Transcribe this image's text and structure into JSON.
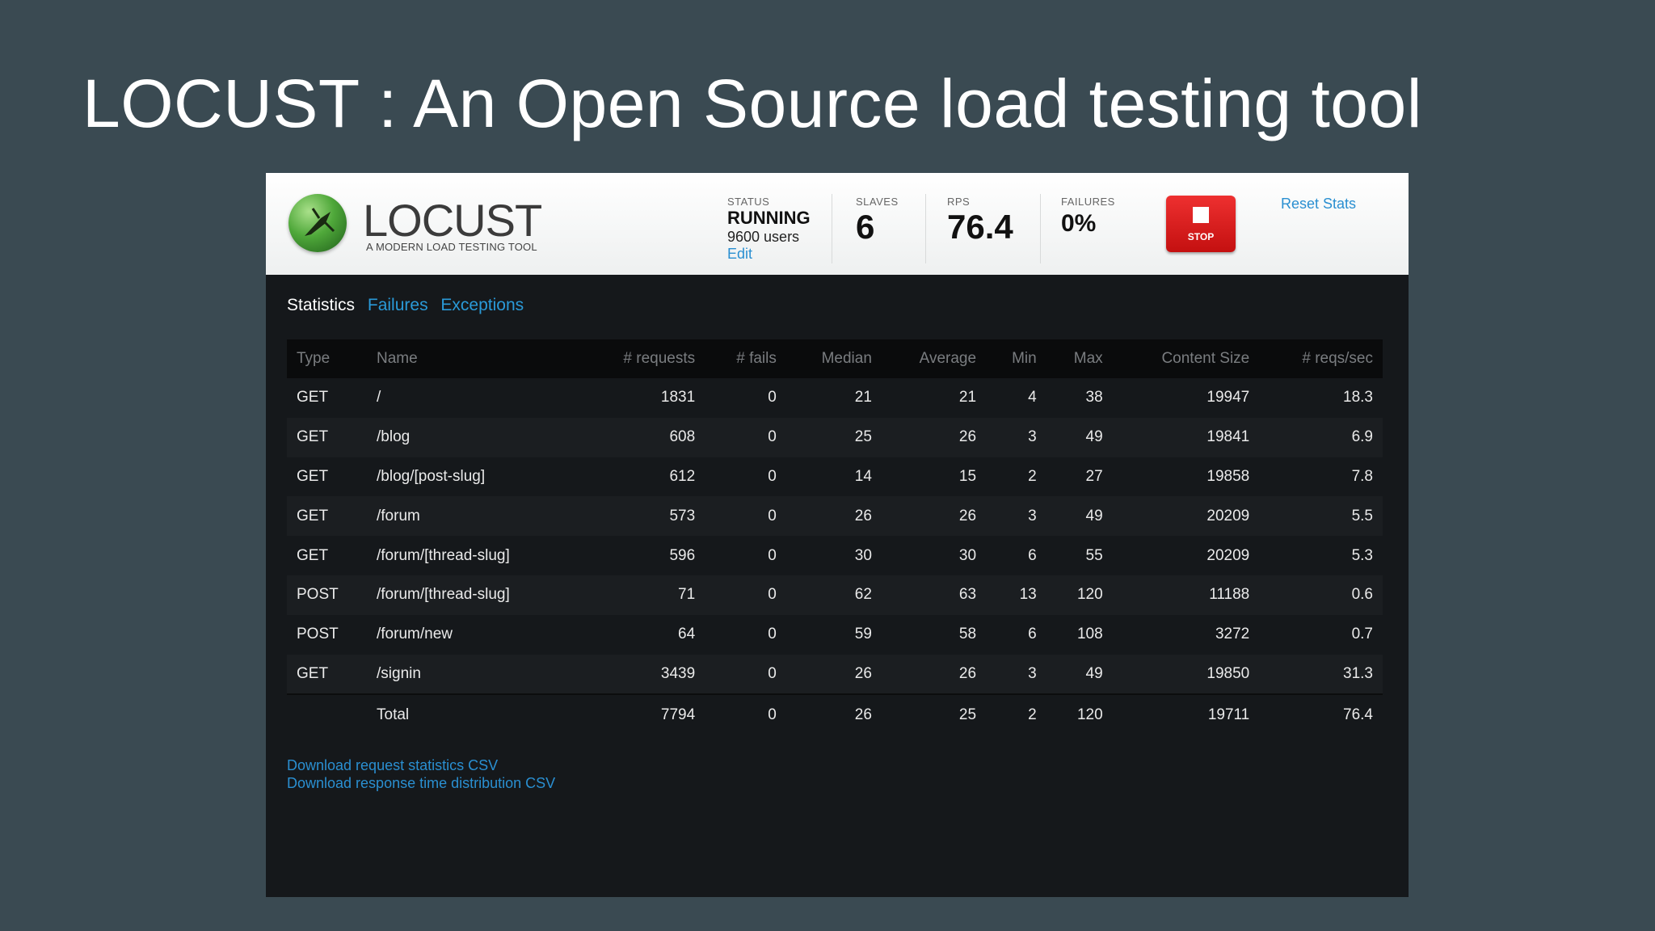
{
  "slide": {
    "title": "LOCUST : An Open Source load testing tool"
  },
  "logo": {
    "name": "LOCUST",
    "tagline": "A MODERN LOAD TESTING TOOL"
  },
  "status": {
    "status_label": "STATUS",
    "status_value": "RUNNING",
    "users": "9600 users",
    "edit": "Edit",
    "slaves_label": "SLAVES",
    "slaves_value": "6",
    "rps_label": "RPS",
    "rps_value": "76.4",
    "failures_label": "FAILURES",
    "failures_value": "0%"
  },
  "stop_button": {
    "label": "STOP"
  },
  "reset_stats": "Reset Stats",
  "tabs": [
    {
      "label": "Statistics"
    },
    {
      "label": "Failures"
    },
    {
      "label": "Exceptions"
    }
  ],
  "table": {
    "headers": [
      "Type",
      "Name",
      "# requests",
      "# fails",
      "Median",
      "Average",
      "Min",
      "Max",
      "Content Size",
      "# reqs/sec"
    ],
    "rows": [
      [
        "GET",
        "/",
        "1831",
        "0",
        "21",
        "21",
        "4",
        "38",
        "19947",
        "18.3"
      ],
      [
        "GET",
        "/blog",
        "608",
        "0",
        "25",
        "26",
        "3",
        "49",
        "19841",
        "6.9"
      ],
      [
        "GET",
        "/blog/[post-slug]",
        "612",
        "0",
        "14",
        "15",
        "2",
        "27",
        "19858",
        "7.8"
      ],
      [
        "GET",
        "/forum",
        "573",
        "0",
        "26",
        "26",
        "3",
        "49",
        "20209",
        "5.5"
      ],
      [
        "GET",
        "/forum/[thread-slug]",
        "596",
        "0",
        "30",
        "30",
        "6",
        "55",
        "20209",
        "5.3"
      ],
      [
        "POST",
        "/forum/[thread-slug]",
        "71",
        "0",
        "62",
        "63",
        "13",
        "120",
        "11188",
        "0.6"
      ],
      [
        "POST",
        "/forum/new",
        "64",
        "0",
        "59",
        "58",
        "6",
        "108",
        "3272",
        "0.7"
      ],
      [
        "GET",
        "/signin",
        "3439",
        "0",
        "26",
        "26",
        "3",
        "49",
        "19850",
        "31.3"
      ]
    ],
    "total": [
      "",
      "Total",
      "7794",
      "0",
      "26",
      "25",
      "2",
      "120",
      "19711",
      "76.4"
    ]
  },
  "downloads": {
    "request_stats": "Download request statistics CSV",
    "response_time": "Download response time distribution CSV"
  },
  "colors": {
    "link": "#2a8fd1",
    "stop": "#d61a1a",
    "background": "#3a4a52",
    "panel": "#15181b"
  }
}
